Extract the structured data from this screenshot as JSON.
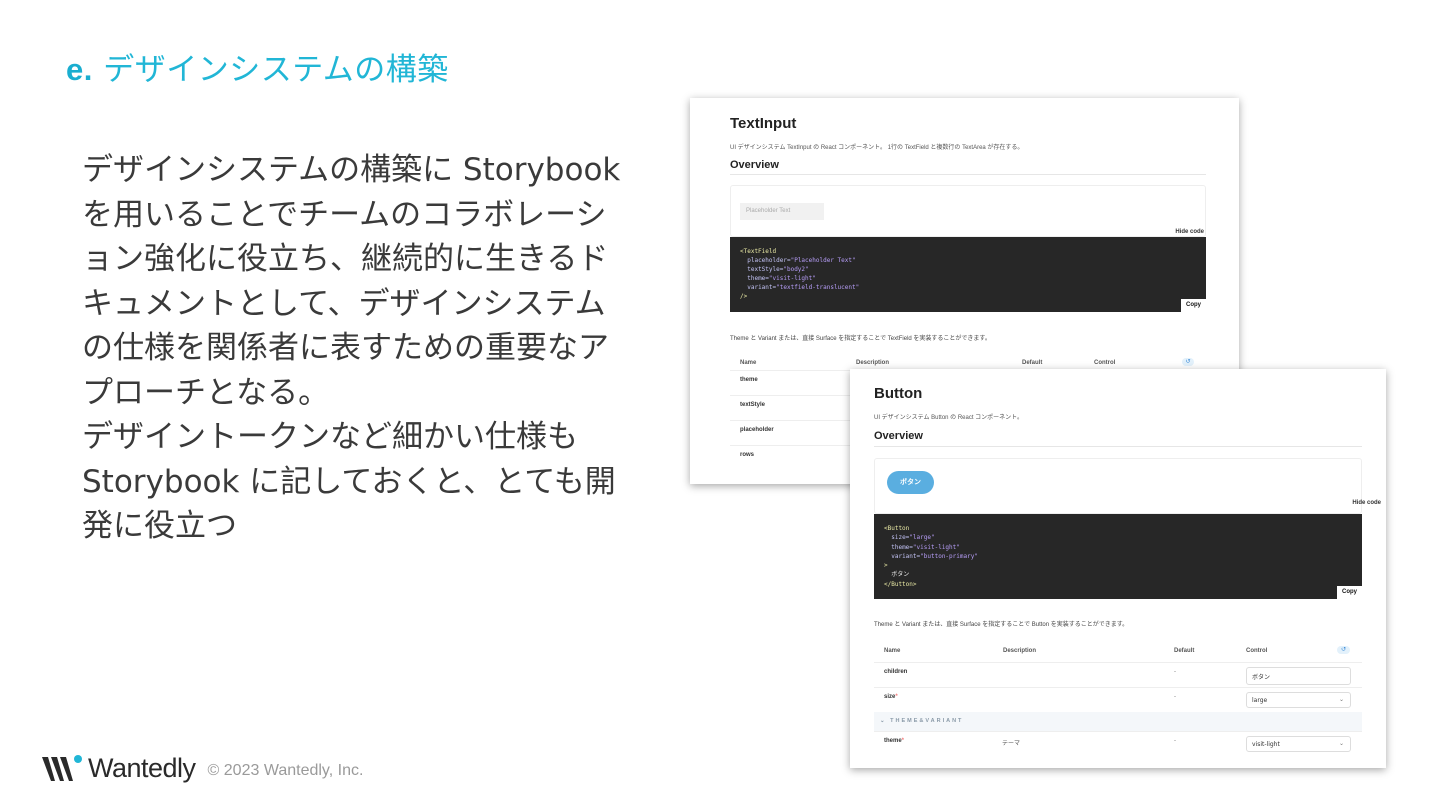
{
  "slide": {
    "title_prefix": "e.",
    "title_text": "デザインシステムの構築",
    "body_paragraph_1": "デザインシステムの構築に Storybook を用いることでチームのコラボレーション強化に役立ち、継続的に生きるドキュメントとして、デザインシステムの仕様を関係者に表すための重要なアプローチとなる。",
    "body_paragraph_2": "デザイントークンなど細かい仕様も Storybook に記しておくと、とても開発に役立つ"
  },
  "footer": {
    "logo_text": "Wantedly",
    "copyright": "© 2023 Wantedly, Inc."
  },
  "textinput_doc": {
    "title": "TextInput",
    "description": "UI デザインシステム TextInput の React コンポーネント。 1行の TextField と複数行の TextArea が存在する。",
    "overview_heading": "Overview",
    "input_placeholder": "Placeholder Text",
    "hide_code": "Hide code",
    "code": {
      "l1_tag": "<TextField",
      "l2_attr": "placeholder=",
      "l2_val": "\"Placeholder Text\"",
      "l3_attr": "textStyle=",
      "l3_val": "\"body2\"",
      "l4_attr": "theme=",
      "l4_val": "\"visit-light\"",
      "l5_attr": "variant=",
      "l5_val": "\"textfield-translucent\"",
      "l6_close": "/>"
    },
    "copy": "Copy",
    "note": "Theme と Variant または、直接 Surface を指定することで TextField を実装することができます。",
    "columns": [
      "Name",
      "Description",
      "Default",
      "Control"
    ],
    "reset_icon": "reset-icon",
    "rows": [
      "theme",
      "textStyle",
      "placeholder",
      "rows"
    ]
  },
  "button_doc": {
    "title": "Button",
    "description": "UI デザインシステム Button の React コンポーネント。",
    "overview_heading": "Overview",
    "button_label": "ボタン",
    "hide_code": "Hide code",
    "code": {
      "l1_tag": "<Button",
      "l2_attr": "size=",
      "l2_val": "\"large\"",
      "l3_attr": "theme=",
      "l3_val": "\"visit-light\"",
      "l4_attr": "variant=",
      "l4_val": "\"button-primary\"",
      "l5_close": ">",
      "l6_text": "ボタン",
      "l7_close": "</Button>"
    },
    "copy": "Copy",
    "note": "Theme と Variant または、直接 Surface を指定することで Button を実装することができます。",
    "columns": [
      "Name",
      "Description",
      "Default",
      "Control"
    ],
    "rows": [
      {
        "name": "children",
        "required": "",
        "description": "",
        "default": "-",
        "control": "ボタン"
      },
      {
        "name": "size",
        "required": "*",
        "description": "",
        "default": "-",
        "control": "large"
      }
    ],
    "group_label": "THEME&VARIANT",
    "group_rows": [
      {
        "name": "theme",
        "required": "*",
        "description": "テーマ",
        "default": "-",
        "control": "visit-light"
      }
    ]
  }
}
